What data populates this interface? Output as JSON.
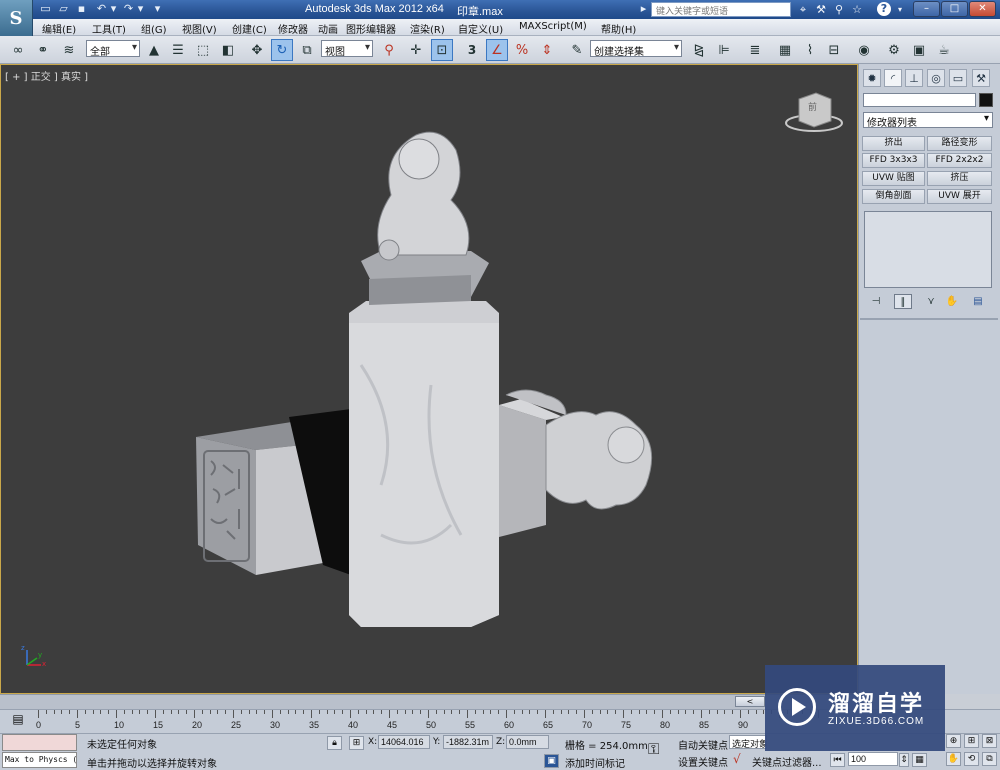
{
  "titlebar": {
    "app_title": "Autodesk 3ds Max  2012 x64",
    "file_name": "印章.max",
    "search_placeholder": "键入关键字或短语",
    "help_label": "?"
  },
  "menu": [
    "编辑(E)",
    "工具(T)",
    "组(G)",
    "视图(V)",
    "创建(C)",
    "修改器",
    "动画",
    "图形编辑器",
    "渲染(R)",
    "自定义(U)",
    "MAXScript(M)",
    "帮助(H)"
  ],
  "toolbar": {
    "selection_filter": "全部",
    "ref_coord": "视图",
    "named_selection": "创建选择集",
    "snap_label": "3",
    "percent_snap": "%"
  },
  "viewport": {
    "label": "[ + ] 正交 ] 真实 ]",
    "viewcube_face": "前",
    "axis_x": "x",
    "axis_y": "y",
    "axis_z": "z"
  },
  "command_panel": {
    "modifier_list": "修改器列表",
    "modifier_buttons": [
      "挤出",
      "路径变形",
      "FFD 3x3x3",
      "FFD 2x2x2",
      "UVW 贴图",
      "挤压",
      "倒角剖面",
      "UVW 展开"
    ]
  },
  "timeline": {
    "thumb": "<",
    "ticks": [
      "0",
      "5",
      "10",
      "15",
      "20",
      "25",
      "30",
      "35",
      "40",
      "45",
      "50",
      "55",
      "60",
      "65",
      "70",
      "75",
      "80",
      "85",
      "90"
    ]
  },
  "status": {
    "maxscript": "Max to Physcs (",
    "selection_status": "未选定任何对象",
    "prompt": "单击并拖动以选择并旋转对象",
    "x_label": "X:",
    "x_value": "14064.016",
    "y_label": "Y:",
    "y_value": "-1882.31m",
    "z_label": "Z:",
    "z_value": "0.0mm",
    "grid": "栅格 = 254.0mm",
    "add_time_tag": "添加时间标记",
    "auto_key": "自动关键点",
    "set_key": "设置关键点",
    "selected_object": "选定对象",
    "key_filters": "关键点过滤器...",
    "frame": "100"
  },
  "watermark": {
    "title": "溜溜自学",
    "url": "ZIXUE.3D66.COM"
  }
}
